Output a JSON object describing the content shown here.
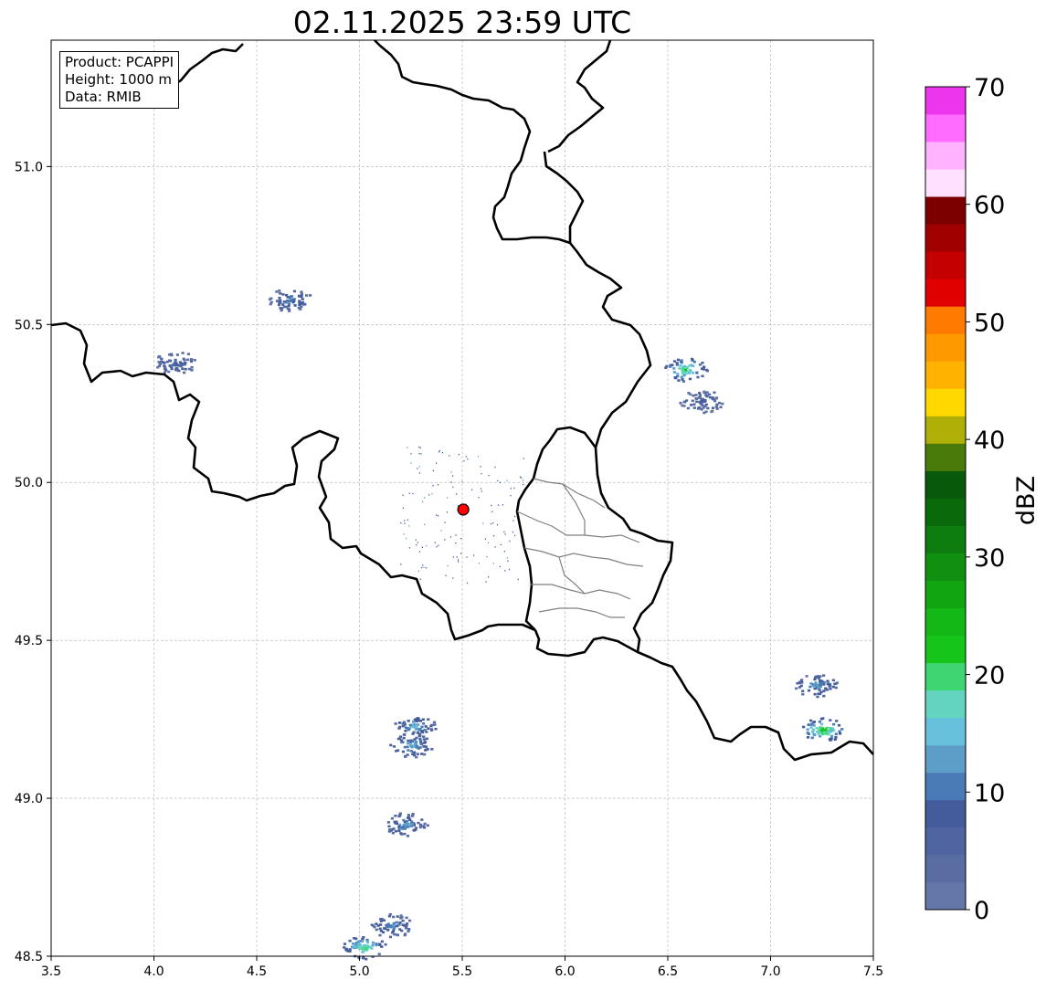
{
  "title": "02.11.2025 23:59 UTC",
  "info": {
    "product": "Product: PCAPPI",
    "height": "Height: 1000 m",
    "data": "Data: RMIB"
  },
  "axes": {
    "x_ticks": [
      "3.5",
      "4.0",
      "4.5",
      "5.0",
      "5.5",
      "6.0",
      "6.5",
      "7.0",
      "7.5"
    ],
    "y_ticks": [
      "48.5",
      "49.0",
      "49.5",
      "50.0",
      "50.5",
      "51.0"
    ],
    "xlim": [
      3.5,
      7.5
    ],
    "ylim": [
      48.5,
      51.4
    ],
    "grid": true
  },
  "colorbar": {
    "label": "dBZ",
    "ticks": [
      "0",
      "10",
      "20",
      "30",
      "40",
      "50",
      "60",
      "70"
    ],
    "range": [
      0,
      70
    ],
    "step": 2.5,
    "colors": [
      "#6577a8",
      "#5a6da3",
      "#4f64a0",
      "#445b9c",
      "#4a7ab5",
      "#5c9ec8",
      "#67c1dc",
      "#63d4c0",
      "#3ed672",
      "#15c519",
      "#13b816",
      "#11a512",
      "#108f10",
      "#0c7c0e",
      "#096a0a",
      "#08590a",
      "#4a7a0a",
      "#afb007",
      "#ffd800",
      "#ffb300",
      "#ff9900",
      "#ff7a00",
      "#e10000",
      "#c40000",
      "#a00000",
      "#7d0000",
      "#ffe0ff",
      "#ffb2ff",
      "#ff6cff",
      "#ee35ee"
    ]
  },
  "radar_site": {
    "lon": 5.505,
    "lat": 49.914,
    "color": "#ff0000"
  },
  "echoes": [
    {
      "lon": 4.66,
      "lat": 50.58,
      "dbz": 12
    },
    {
      "lon": 4.1,
      "lat": 50.38,
      "dbz": 10
    },
    {
      "lon": 6.58,
      "lat": 50.36,
      "dbz": 22
    },
    {
      "lon": 6.66,
      "lat": 50.26,
      "dbz": 8
    },
    {
      "lon": 7.22,
      "lat": 49.36,
      "dbz": 14
    },
    {
      "lon": 7.25,
      "lat": 49.22,
      "dbz": 25
    },
    {
      "lon": 5.26,
      "lat": 49.23,
      "dbz": 16
    },
    {
      "lon": 5.25,
      "lat": 49.17,
      "dbz": 15
    },
    {
      "lon": 5.22,
      "lat": 48.92,
      "dbz": 14
    },
    {
      "lon": 5.15,
      "lat": 48.6,
      "dbz": 13
    },
    {
      "lon": 5.02,
      "lat": 48.53,
      "dbz": 22
    }
  ],
  "border_color": "#000000",
  "admin_border_color": "#808080"
}
